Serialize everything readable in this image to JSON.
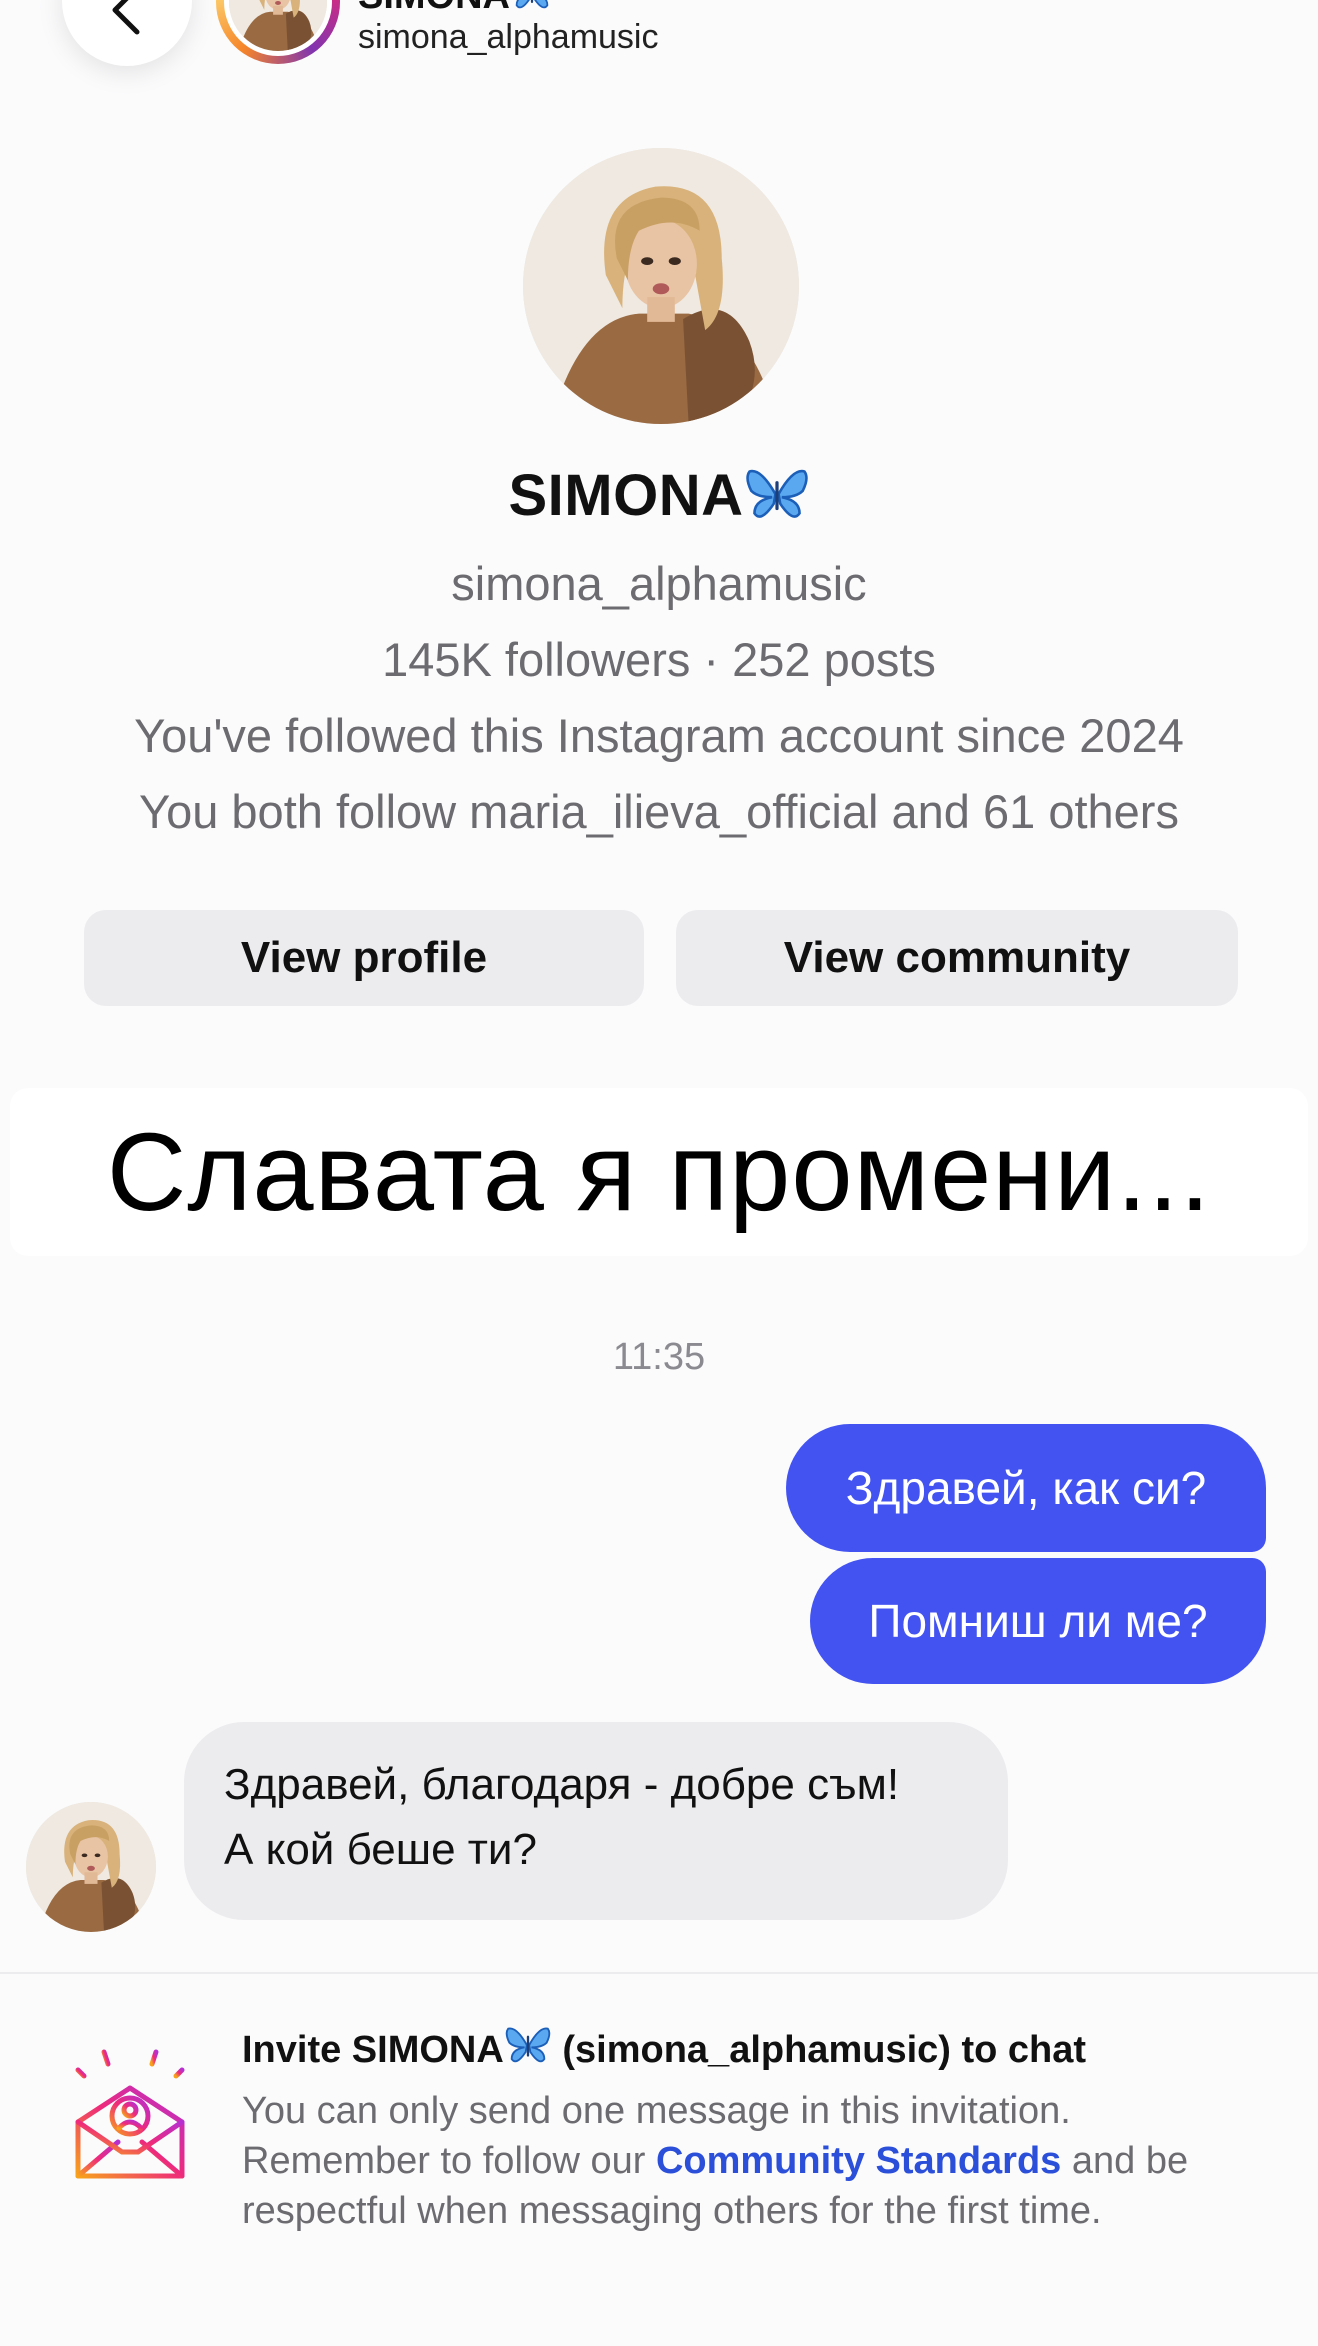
{
  "header": {
    "name": "SIMONA",
    "name_emoji_icon": "butterfly-icon",
    "username": "simona_alphamusic",
    "back_icon": "chevron-left-icon"
  },
  "profile": {
    "name": "SIMONA",
    "username": "simona_alphamusic",
    "stats": "145K followers · 252 posts",
    "followed_since": "You've followed this Instagram account since 2024",
    "mutual": "You both follow maria_ilieva_official and 61 others",
    "view_profile_label": "View profile",
    "view_community_label": "View community"
  },
  "caption": {
    "text": "Славата я промени..."
  },
  "chat": {
    "timestamp": "11:35",
    "outgoing": [
      "Здравей, как си?",
      "Помниш ли ме?"
    ],
    "incoming": {
      "line1": "Здравей, благодаря - добре съм!",
      "line2": "А кой беше ти?"
    },
    "colors": {
      "outgoing_bubble": "#4353f1",
      "incoming_bubble": "#ececef"
    }
  },
  "invite": {
    "title_prefix": "Invite SIMONA",
    "title_suffix": " (simona_alphamusic) to chat",
    "body_1": "You can only send one message in this invitation. Remember to follow our ",
    "link": "Community Standards",
    "body_2": " and be respectful when messaging others for the first time.",
    "icon": "invite-envelope-icon",
    "link_color": "#2b4fd9"
  }
}
